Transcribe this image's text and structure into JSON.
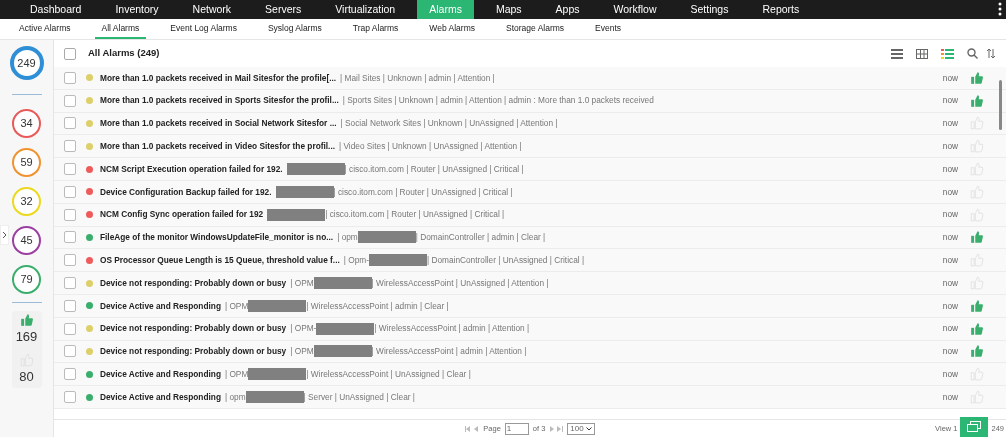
{
  "nav": [
    {
      "label": "Dashboard",
      "selected": false
    },
    {
      "label": "Inventory",
      "selected": false
    },
    {
      "label": "Network",
      "selected": false
    },
    {
      "label": "Servers",
      "selected": false
    },
    {
      "label": "Virtualization",
      "selected": false
    },
    {
      "label": "Alarms",
      "selected": true
    },
    {
      "label": "Maps",
      "selected": false
    },
    {
      "label": "Apps",
      "selected": false
    },
    {
      "label": "Workflow",
      "selected": false
    },
    {
      "label": "Settings",
      "selected": false
    },
    {
      "label": "Reports",
      "selected": false
    }
  ],
  "subtabs": [
    {
      "label": "Active Alarms",
      "selected": false
    },
    {
      "label": "All Alarms",
      "selected": true
    },
    {
      "label": "Event Log Alarms",
      "selected": false
    },
    {
      "label": "Syslog Alarms",
      "selected": false
    },
    {
      "label": "Trap Alarms",
      "selected": false
    },
    {
      "label": "Web Alarms",
      "selected": false
    },
    {
      "label": "Storage Alarms",
      "selected": false
    },
    {
      "label": "Events",
      "selected": false
    }
  ],
  "summary": {
    "total": "249",
    "severities": [
      {
        "count": "34",
        "color": "#e85a5a"
      },
      {
        "count": "59",
        "color": "#f0922e"
      },
      {
        "count": "32",
        "color": "#ecd81c"
      },
      {
        "count": "45",
        "color": "#9b3fa0"
      },
      {
        "count": "79",
        "color": "#3aae6c"
      }
    ],
    "acknowledged": "169",
    "unacknowledged": "80"
  },
  "list_title": "All Alarms (249)",
  "select_all_checked": false,
  "rows": [
    {
      "color": "#ddd06a",
      "checked": false,
      "segments": [
        {
          "kind": "title",
          "text": "More than 1.0 packets received in Mail Sitesfor the profile[..."
        },
        {
          "kind": "detail",
          "text": "| Mail Sites | Unknown | admin | Attention |"
        }
      ],
      "time": "now",
      "acknowledged": true
    },
    {
      "color": "#ddd06a",
      "checked": false,
      "segments": [
        {
          "kind": "title",
          "text": "More than 1.0 packets received in Sports Sitesfor the profil..."
        },
        {
          "kind": "detail",
          "text": "| Sports Sites | Unknown | admin | Attention | admin : More than 1.0 packets received"
        }
      ],
      "time": "now",
      "acknowledged": true
    },
    {
      "color": "#ddd06a",
      "checked": false,
      "segments": [
        {
          "kind": "title",
          "text": "More than 1.0 packets received in Social Network Sitesfor ..."
        },
        {
          "kind": "detail",
          "text": "| Social Network Sites | Unknown | UnAssigned | Attention |"
        }
      ],
      "time": "now",
      "acknowledged": false
    },
    {
      "color": "#ddd06a",
      "checked": false,
      "segments": [
        {
          "kind": "title",
          "text": "More than 1.0 packets received in Video Sitesfor the profil..."
        },
        {
          "kind": "detail",
          "text": "| Video Sites | Unknown | UnAssigned | Attention |"
        }
      ],
      "time": "now",
      "acknowledged": false
    },
    {
      "color": "#ef5b5b",
      "checked": false,
      "segments": [
        {
          "kind": "title",
          "text": "NCM Script Execution operation failed for 192."
        },
        {
          "kind": "redacted"
        },
        {
          "kind": "detail",
          "text": "| cisco.itom.com | Router | UnAssigned | Critical |"
        }
      ],
      "time": "now",
      "acknowledged": false
    },
    {
      "color": "#ef5b5b",
      "checked": false,
      "segments": [
        {
          "kind": "title",
          "text": "Device Configuration Backup failed for 192."
        },
        {
          "kind": "redacted"
        },
        {
          "kind": "detail",
          "text": "| cisco.itom.com | Router | UnAssigned | Critical |"
        }
      ],
      "time": "now",
      "acknowledged": false
    },
    {
      "color": "#ef5b5b",
      "checked": false,
      "segments": [
        {
          "kind": "title",
          "text": "NCM Config Sync operation failed for 192"
        },
        {
          "kind": "redacted"
        },
        {
          "kind": "detail",
          "text": "| cisco.itom.com | Router | UnAssigned | Critical |"
        }
      ],
      "time": "now",
      "acknowledged": false
    },
    {
      "color": "#3aae6c",
      "checked": false,
      "segments": [
        {
          "kind": "title",
          "text": "FileAge of the monitor WindowsUpdateFile_monitor is no..."
        },
        {
          "kind": "detail",
          "text": "| opm"
        },
        {
          "kind": "redacted"
        },
        {
          "kind": "detail",
          "text": "| DomainController | admin | Clear |"
        }
      ],
      "time": "now",
      "acknowledged": true
    },
    {
      "color": "#ef5b5b",
      "checked": false,
      "segments": [
        {
          "kind": "title",
          "text": "OS Processor Queue Length is 15 Queue, threshold value f..."
        },
        {
          "kind": "detail",
          "text": "| Opm-"
        },
        {
          "kind": "redacted"
        },
        {
          "kind": "detail",
          "text": "| DomainController | UnAssigned | Critical |"
        }
      ],
      "time": "now",
      "acknowledged": false
    },
    {
      "color": "#ddd06a",
      "checked": false,
      "segments": [
        {
          "kind": "title",
          "text": "Device not responding: Probably down or busy"
        },
        {
          "kind": "detail",
          "text": "| OPM"
        },
        {
          "kind": "redacted"
        },
        {
          "kind": "detail",
          "text": "| WirelessAccessPoint | UnAssigned | Attention |"
        }
      ],
      "time": "now",
      "acknowledged": false
    },
    {
      "color": "#3aae6c",
      "checked": false,
      "segments": [
        {
          "kind": "title",
          "text": "Device Active and Responding"
        },
        {
          "kind": "detail",
          "text": "| OPM"
        },
        {
          "kind": "redacted"
        },
        {
          "kind": "detail",
          "text": "| WirelessAccessPoint | admin | Clear |"
        }
      ],
      "time": "now",
      "acknowledged": true
    },
    {
      "color": "#ddd06a",
      "checked": false,
      "segments": [
        {
          "kind": "title",
          "text": "Device not responding: Probably down or busy"
        },
        {
          "kind": "detail",
          "text": "| OPM-"
        },
        {
          "kind": "redacted"
        },
        {
          "kind": "detail",
          "text": "| WirelessAccessPoint | admin | Attention |"
        }
      ],
      "time": "now",
      "acknowledged": true
    },
    {
      "color": "#ddd06a",
      "checked": false,
      "segments": [
        {
          "kind": "title",
          "text": "Device not responding: Probably down or busy"
        },
        {
          "kind": "detail",
          "text": "| OPM"
        },
        {
          "kind": "redacted"
        },
        {
          "kind": "detail",
          "text": "| WirelessAccessPoint | admin | Attention |"
        }
      ],
      "time": "now",
      "acknowledged": true
    },
    {
      "color": "#3aae6c",
      "checked": false,
      "segments": [
        {
          "kind": "title",
          "text": "Device Active and Responding"
        },
        {
          "kind": "detail",
          "text": "| OPM"
        },
        {
          "kind": "redacted"
        },
        {
          "kind": "detail",
          "text": "| WirelessAccessPoint | UnAssigned | Clear |"
        }
      ],
      "time": "now",
      "acknowledged": false
    },
    {
      "color": "#3aae6c",
      "checked": false,
      "segments": [
        {
          "kind": "title",
          "text": "Device Active and Responding"
        },
        {
          "kind": "detail",
          "text": "| opm"
        },
        {
          "kind": "redacted"
        },
        {
          "kind": "detail",
          "text": "| Server | UnAssigned | Clear |"
        }
      ],
      "time": "now",
      "acknowledged": false
    }
  ],
  "pager": {
    "label": "Page",
    "page": "1",
    "of": "of 3",
    "per_page": "100",
    "view_start": "View 1",
    "view_end": "249"
  }
}
